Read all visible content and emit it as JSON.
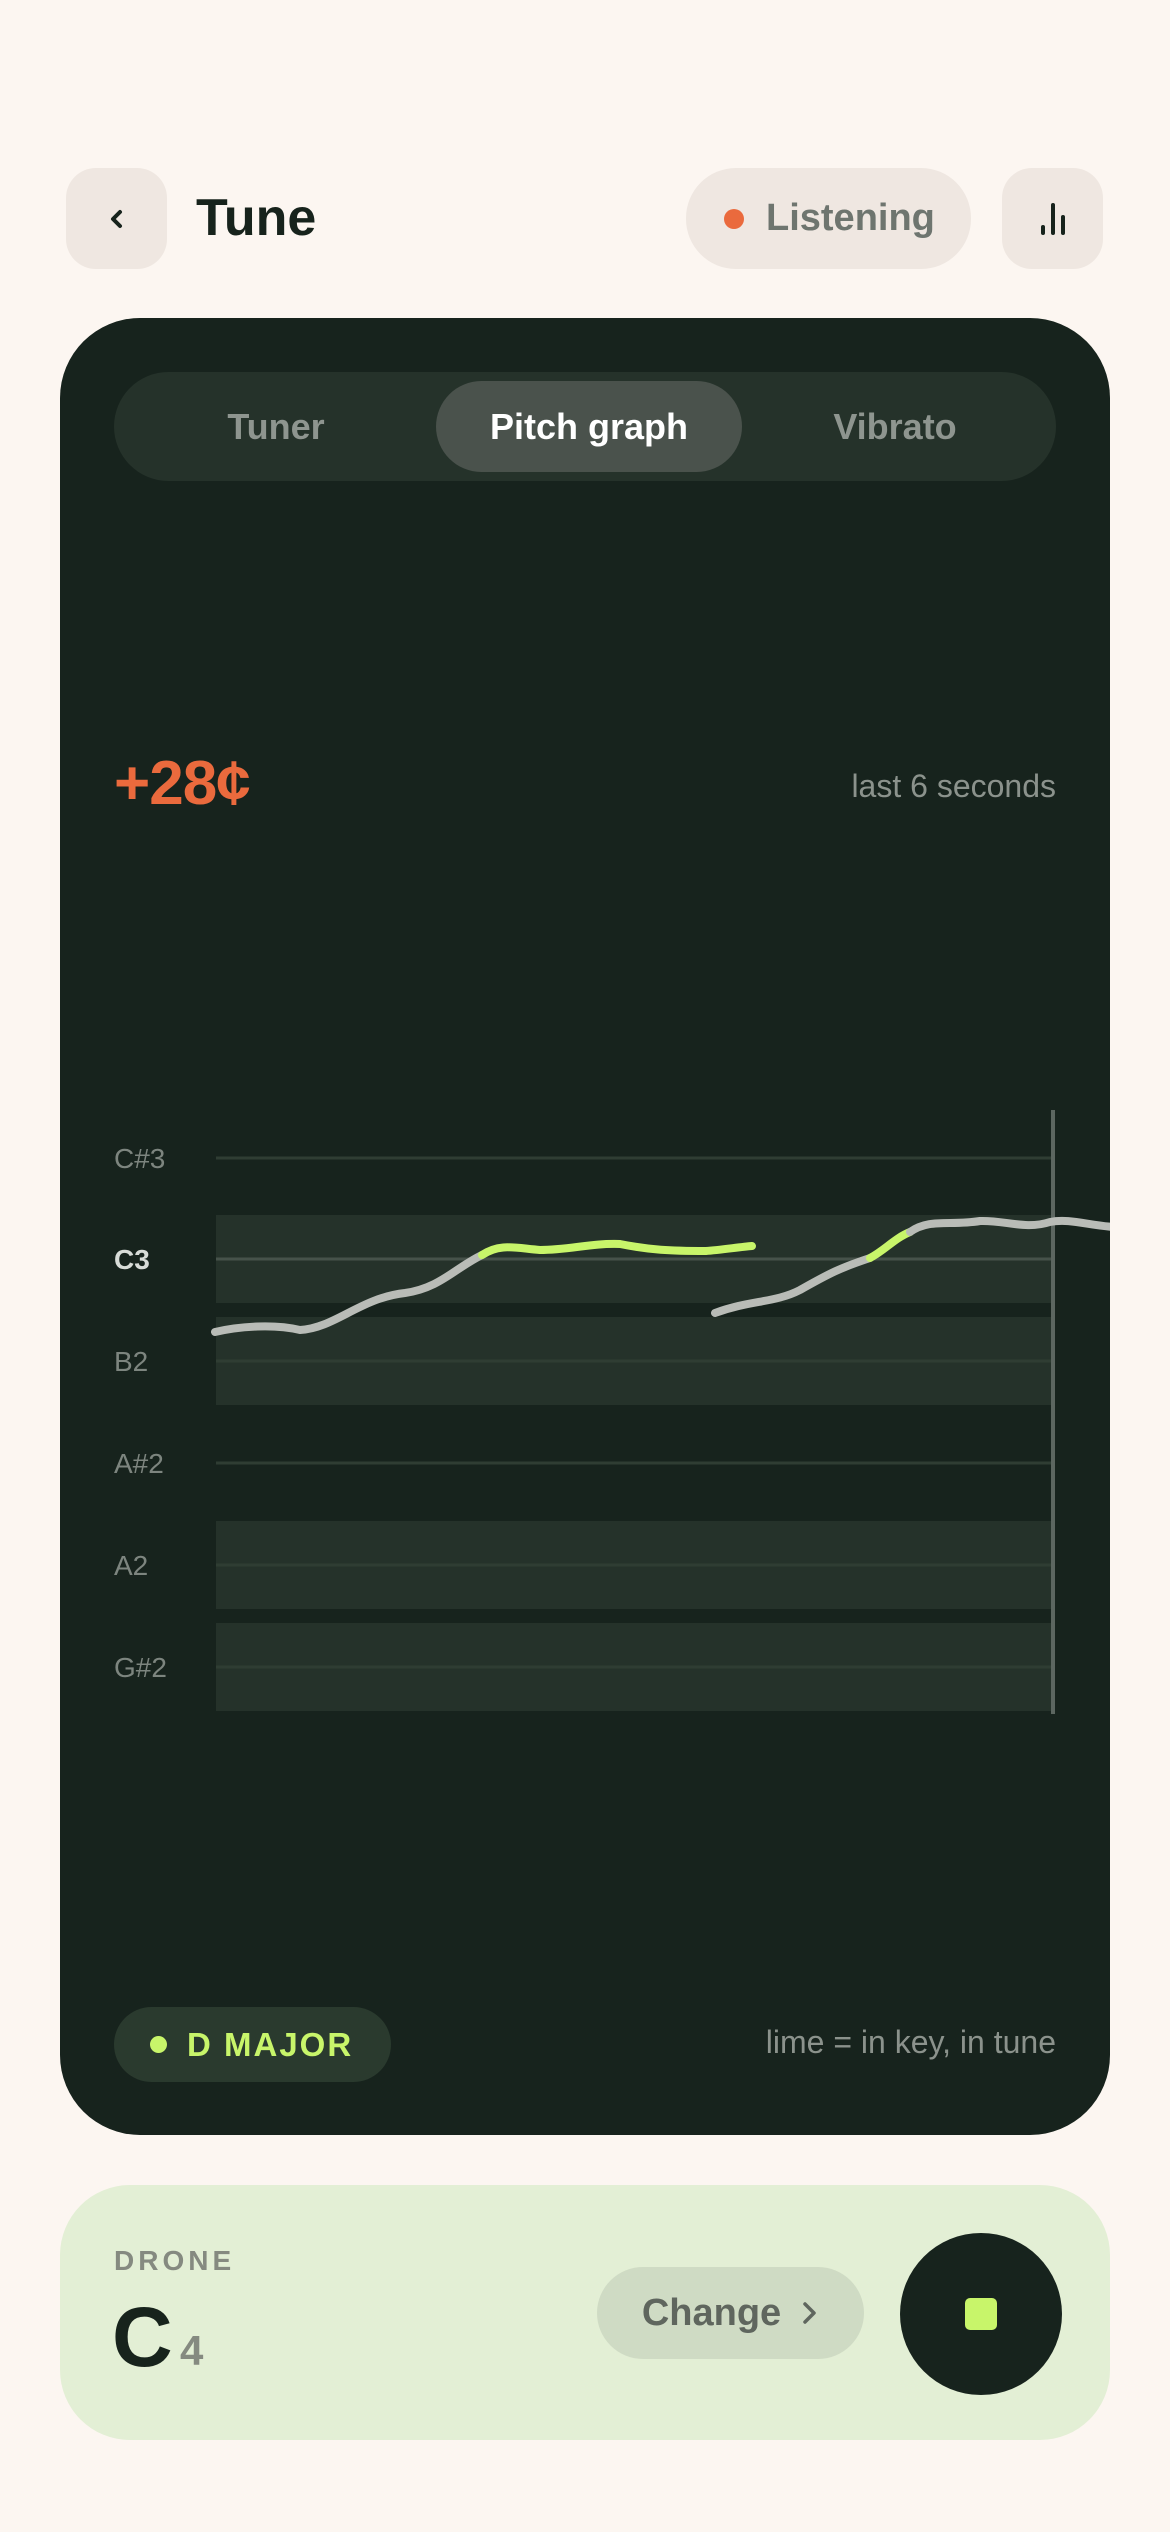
{
  "header": {
    "back_icon": "chevron-left-icon",
    "title": "Tune",
    "status": {
      "label": "Listening",
      "dot_color": "#ea6a3d"
    },
    "stats_icon": "bar-chart-icon"
  },
  "tabs": [
    {
      "label": "Tuner",
      "active": false
    },
    {
      "label": "Pitch graph",
      "active": true
    },
    {
      "label": "Vibrato",
      "active": false
    }
  ],
  "readout": {
    "cents": "+28¢",
    "window": "last 6 seconds"
  },
  "pitch_graph": {
    "notes": [
      "C#3",
      "C3",
      "B2",
      "A#2",
      "A2",
      "G#2"
    ],
    "current_note": "C3",
    "in_key_notes": [
      "C#3",
      "B2",
      "A2",
      "G#2"
    ],
    "in_tune_color": "#c8f56a",
    "off_color": "#b9bcb7"
  },
  "footer": {
    "key": "D MAJOR",
    "legend": "lime = in key, in tune"
  },
  "drone": {
    "caption": "DRONE",
    "note": "C",
    "octave": "4",
    "change_label": "Change",
    "stop_icon": "stop-icon"
  }
}
